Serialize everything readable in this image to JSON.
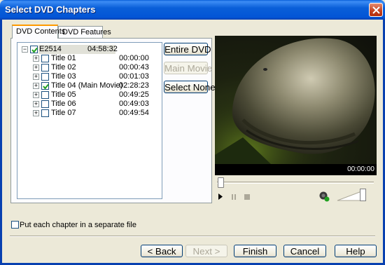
{
  "window": {
    "title": "Select DVD Chapters"
  },
  "tabs": [
    {
      "label": "DVD Contents",
      "active": true
    },
    {
      "label": "DVD Features",
      "active": false
    }
  ],
  "tree": {
    "root": {
      "label": "E2514",
      "time": "04:58:32",
      "checked": true
    },
    "items": [
      {
        "label": "Title 01",
        "time": "00:00:00",
        "checked": false
      },
      {
        "label": "Title 02",
        "time": "00:00:43",
        "checked": false
      },
      {
        "label": "Title 03",
        "time": "00:01:03",
        "checked": false
      },
      {
        "label": "Title 04 (Main Movie)",
        "time": "02:28:23",
        "checked": true
      },
      {
        "label": "Title 05",
        "time": "00:49:25",
        "checked": false
      },
      {
        "label": "Title 06",
        "time": "00:49:03",
        "checked": false
      },
      {
        "label": "Title 07",
        "time": "00:49:54",
        "checked": false
      }
    ]
  },
  "side_buttons": {
    "entire_dvd": "Entire DVD",
    "main_movie": "Main Movie",
    "select_none": "Select None"
  },
  "player": {
    "time": "00:00:00",
    "seek_position": 0,
    "volume_level": 1.0
  },
  "options": {
    "separate_file_label": "Put each chapter in a separate file",
    "separate_file_checked": false
  },
  "footer": {
    "back": "< Back",
    "next": "Next >",
    "finish": "Finish",
    "cancel": "Cancel",
    "help": "Help"
  },
  "colors": {
    "titlebar": "#0a5fd8",
    "dialog_bg": "#ece9d8",
    "tab_accent": "#ff9a00",
    "checkbox_check": "#21a121"
  }
}
